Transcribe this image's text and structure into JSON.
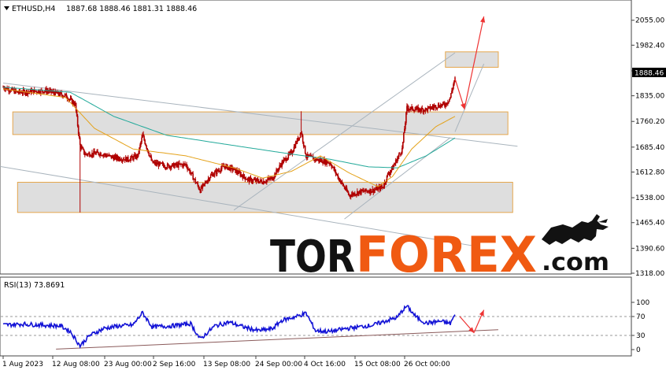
{
  "header": {
    "symbol_timeframe": "ETHUSD,H4",
    "ohlc": "1887.68 1888.46 1881.31 1888.46"
  },
  "rsi_header": "RSI(13) 73.8691",
  "current_price_label": "1888.46",
  "logo": {
    "part1": "TOR",
    "part2": "FOREX",
    "part3": ".com"
  },
  "colors": {
    "candle": "#b00000",
    "ma_fast": "#e4a21a",
    "ma_slow": "#22a99a",
    "channel": "#a9b4bd",
    "zone_fill": "#dedede",
    "zone_border": "#e5a64c",
    "arrow": "#ee3333",
    "rsi_line": "#1212d6",
    "rsi_trend": "#8a5a5a",
    "price_tag_bg": "#000000",
    "logo_dark": "#121212",
    "logo_orange": "#f05a12"
  },
  "chart_data": [
    {
      "type": "candlestick",
      "title": "",
      "ylim": [
        1318,
        2075
      ],
      "y_ticks": [
        "2055.00",
        "1982.40",
        "1907.60",
        "1835.00",
        "1760.20",
        "1685.40",
        "1612.80",
        "1538.00",
        "1465.40",
        "1390.60",
        "1318.00"
      ],
      "x_ticks": [
        "1 Aug 2023",
        "12 Aug 08:00",
        "23 Aug 00:00",
        "2 Sep 16:00",
        "13 Sep 08:00",
        "24 Sep 00:00",
        "4 Oct 16:00",
        "15 Oct 08:00",
        "26 Oct 00:00"
      ],
      "x_start": "2023-08-01",
      "x_end": "2023-11-03",
      "price_path": [
        [
          "2023-08-01",
          1860
        ],
        [
          "2023-08-04",
          1845
        ],
        [
          "2023-08-07",
          1848
        ],
        [
          "2023-08-10",
          1850
        ],
        [
          "2023-08-14",
          1835
        ],
        [
          "2023-08-16",
          1810
        ],
        [
          "2023-08-17",
          1690
        ],
        [
          "2023-08-18",
          1665
        ],
        [
          "2023-08-21",
          1668
        ],
        [
          "2023-08-24",
          1655
        ],
        [
          "2023-08-27",
          1650
        ],
        [
          "2023-08-29",
          1660
        ],
        [
          "2023-08-30",
          1720
        ],
        [
          "2023-09-01",
          1640
        ],
        [
          "2023-09-04",
          1630
        ],
        [
          "2023-09-08",
          1635
        ],
        [
          "2023-09-11",
          1560
        ],
        [
          "2023-09-13",
          1600
        ],
        [
          "2023-09-16",
          1630
        ],
        [
          "2023-09-18",
          1620
        ],
        [
          "2023-09-21",
          1590
        ],
        [
          "2023-09-24",
          1585
        ],
        [
          "2023-09-26",
          1595
        ],
        [
          "2023-09-28",
          1640
        ],
        [
          "2023-09-30",
          1670
        ],
        [
          "2023-10-02",
          1730
        ],
        [
          "2023-10-03",
          1660
        ],
        [
          "2023-10-05",
          1650
        ],
        [
          "2023-10-08",
          1640
        ],
        [
          "2023-10-10",
          1590
        ],
        [
          "2023-10-12",
          1545
        ],
        [
          "2023-10-14",
          1555
        ],
        [
          "2023-10-17",
          1560
        ],
        [
          "2023-10-19",
          1570
        ],
        [
          "2023-10-20",
          1605
        ],
        [
          "2023-10-21",
          1625
        ],
        [
          "2023-10-23",
          1680
        ],
        [
          "2023-10-24",
          1800
        ],
        [
          "2023-10-26",
          1795
        ],
        [
          "2023-10-28",
          1795
        ],
        [
          "2023-10-30",
          1805
        ],
        [
          "2023-11-01",
          1810
        ],
        [
          "2023-11-02",
          1830
        ],
        [
          "2023-11-03",
          1888.46
        ]
      ],
      "ma_fast_path": [
        [
          "2023-08-01",
          1855
        ],
        [
          "2023-08-14",
          1830
        ],
        [
          "2023-08-20",
          1740
        ],
        [
          "2023-08-28",
          1680
        ],
        [
          "2023-09-08",
          1660
        ],
        [
          "2023-09-18",
          1625
        ],
        [
          "2023-09-24",
          1595
        ],
        [
          "2023-09-30",
          1615
        ],
        [
          "2023-10-06",
          1660
        ],
        [
          "2023-10-12",
          1610
        ],
        [
          "2023-10-18",
          1570
        ],
        [
          "2023-10-21",
          1600
        ],
        [
          "2023-10-25",
          1680
        ],
        [
          "2023-10-30",
          1745
        ],
        [
          "2023-11-03",
          1775
        ]
      ],
      "ma_slow_path": [
        [
          "2023-08-01",
          1860
        ],
        [
          "2023-08-15",
          1845
        ],
        [
          "2023-08-24",
          1775
        ],
        [
          "2023-09-04",
          1720
        ],
        [
          "2023-09-18",
          1690
        ],
        [
          "2023-09-30",
          1665
        ],
        [
          "2023-10-08",
          1650
        ],
        [
          "2023-10-16",
          1628
        ],
        [
          "2023-10-22",
          1625
        ],
        [
          "2023-10-28",
          1660
        ],
        [
          "2023-11-03",
          1712
        ]
      ],
      "zones": [
        {
          "x0": "2023-11-01",
          "x1": "2023-11-12",
          "y0": 1918,
          "y1": 1963
        },
        {
          "x0": "2023-08-03",
          "x1": "2023-11-14",
          "y0": 1722,
          "y1": 1788
        },
        {
          "x0": "2023-08-04",
          "x1": "2023-11-15",
          "y0": 1495,
          "y1": 1583
        }
      ],
      "channel_lines": [
        {
          "x0": "2023-08-01",
          "y0": 1872,
          "x1": "2023-11-16",
          "y1": 1688
        },
        {
          "x0": "2023-07-31",
          "y0": 1630,
          "x1": "2023-11-08",
          "y1": 1395
        },
        {
          "x0": "2023-09-18",
          "y0": 1502,
          "x1": "2023-11-03",
          "y1": 1960
        },
        {
          "x0": "2023-10-11",
          "y0": 1476,
          "x1": "2023-11-02",
          "y1": 1713
        },
        {
          "x0": "2023-11-03",
          "y0": 1730,
          "x1": "2023-11-09",
          "y1": 1928
        }
      ],
      "forecast_arrows": [
        {
          "x0": "2023-11-03",
          "y0": 1885,
          "x1": "2023-11-05",
          "y1": 1795
        },
        {
          "x0": "2023-11-05",
          "y0": 1800,
          "x1": "2023-11-09",
          "y1": 2066
        }
      ]
    },
    {
      "type": "line",
      "title": "",
      "ylim": [
        0,
        100
      ],
      "y_ticks": [
        100,
        70,
        30,
        0
      ],
      "dashed_levels": [
        70,
        30
      ],
      "rsi_path": [
        [
          "2023-08-01",
          52
        ],
        [
          "2023-08-05",
          54
        ],
        [
          "2023-08-09",
          52
        ],
        [
          "2023-08-13",
          50
        ],
        [
          "2023-08-15",
          38
        ],
        [
          "2023-08-17",
          8
        ],
        [
          "2023-08-19",
          30
        ],
        [
          "2023-08-22",
          45
        ],
        [
          "2023-08-25",
          50
        ],
        [
          "2023-08-28",
          52
        ],
        [
          "2023-08-30",
          78
        ],
        [
          "2023-09-01",
          48
        ],
        [
          "2023-09-05",
          50
        ],
        [
          "2023-09-09",
          55
        ],
        [
          "2023-09-11",
          22
        ],
        [
          "2023-09-14",
          50
        ],
        [
          "2023-09-17",
          58
        ],
        [
          "2023-09-20",
          48
        ],
        [
          "2023-09-23",
          40
        ],
        [
          "2023-09-26",
          44
        ],
        [
          "2023-09-28",
          62
        ],
        [
          "2023-10-01",
          70
        ],
        [
          "2023-10-03",
          77
        ],
        [
          "2023-10-05",
          40
        ],
        [
          "2023-10-08",
          38
        ],
        [
          "2023-10-11",
          44
        ],
        [
          "2023-10-14",
          48
        ],
        [
          "2023-10-17",
          52
        ],
        [
          "2023-10-20",
          62
        ],
        [
          "2023-10-22",
          68
        ],
        [
          "2023-10-23",
          82
        ],
        [
          "2023-10-24",
          92
        ],
        [
          "2023-10-26",
          68
        ],
        [
          "2023-10-28",
          56
        ],
        [
          "2023-10-31",
          60
        ],
        [
          "2023-11-02",
          55
        ],
        [
          "2023-11-03",
          73.87
        ]
      ],
      "trend_line": {
        "x0": "2023-08-12",
        "y0": 1,
        "x1": "2023-11-12",
        "y1": 42
      },
      "forecast_arrows": [
        {
          "x0": "2023-11-04",
          "y0": 70,
          "x1": "2023-11-07",
          "y1": 35
        },
        {
          "x0": "2023-11-07",
          "y0": 37,
          "x1": "2023-11-09",
          "y1": 84
        }
      ]
    }
  ]
}
